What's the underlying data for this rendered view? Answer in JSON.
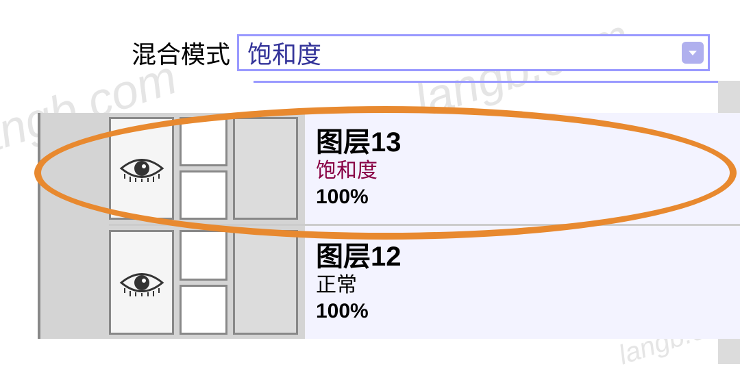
{
  "blend_mode": {
    "label": "混合模式",
    "value": "饱和度"
  },
  "layers": [
    {
      "name": "图层13",
      "blend": "饱和度",
      "opacity": "100%",
      "blend_style": "saturation"
    },
    {
      "name": "图层12",
      "blend": "正常",
      "opacity": "100%",
      "blend_style": "normal"
    }
  ],
  "watermark": "langb.com"
}
